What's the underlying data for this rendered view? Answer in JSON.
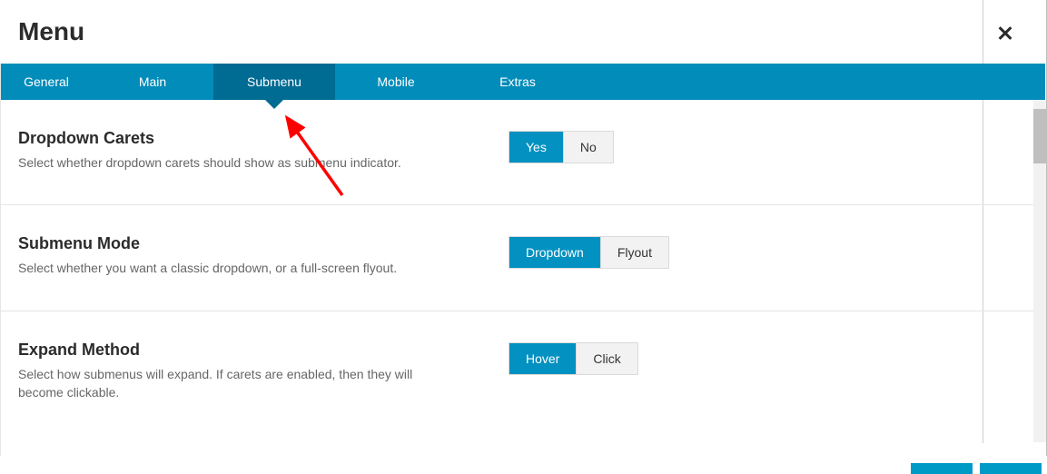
{
  "header": {
    "title": "Menu"
  },
  "tabs": [
    "General",
    "Main",
    "Submenu",
    "Mobile",
    "Extras"
  ],
  "active_tab_index": 2,
  "sections": [
    {
      "title": "Dropdown Carets",
      "desc": "Select whether dropdown carets should show as submenu indicator.",
      "options": [
        "Yes",
        "No"
      ],
      "selected": 0
    },
    {
      "title": "Submenu Mode",
      "desc": "Select whether you want a classic dropdown, or a full-screen flyout.",
      "options": [
        "Dropdown",
        "Flyout"
      ],
      "selected": 0
    },
    {
      "title": "Expand Method",
      "desc": "Select how submenus will expand. If carets are enabled, then they will become clickable.",
      "options": [
        "Hover",
        "Click"
      ],
      "selected": 0
    }
  ],
  "colors": {
    "accent": "#028cba",
    "accent_dark": "#006b93"
  }
}
